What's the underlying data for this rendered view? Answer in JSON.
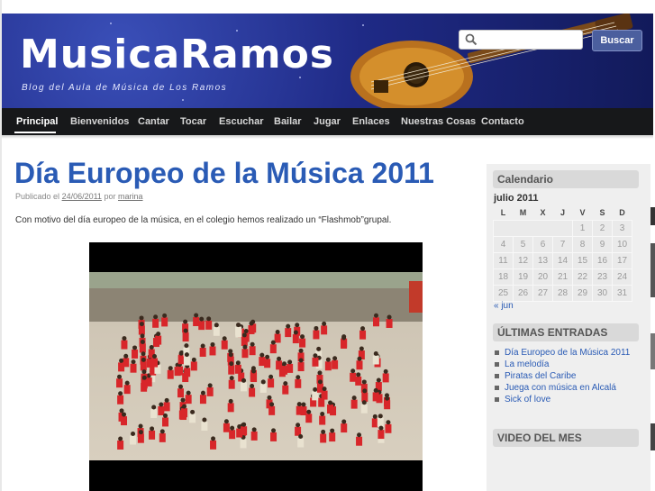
{
  "header": {
    "site_title": "MusicaRamos",
    "tagline": "Blog del Aula de Música de Los Ramos",
    "search_placeholder": "",
    "search_button": "Buscar"
  },
  "nav": {
    "items": [
      "Principal",
      "Bienvenidos",
      "Cantar",
      "Tocar",
      "Escuchar",
      "Bailar",
      "Jugar",
      "Enlaces",
      "Nuestras Cosas",
      "Contacto"
    ],
    "active": "Principal"
  },
  "post": {
    "title": "Día Europeo de la Música 2011",
    "published_prefix": "Publicado el",
    "date": "24/06/2011",
    "by": "por",
    "author": "marina",
    "intro": "Con motivo del día europeo de la música, en el colegio hemos realizado un “Flashmob”grupal."
  },
  "sidebar": {
    "calendar_title": "Calendario",
    "calendar_caption": "julio 2011",
    "weekdays": [
      "L",
      "M",
      "X",
      "J",
      "V",
      "S",
      "D"
    ],
    "weeks": [
      [
        "",
        "",
        "",
        "",
        "1",
        "2",
        "3"
      ],
      [
        "4",
        "5",
        "6",
        "7",
        "8",
        "9",
        "10"
      ],
      [
        "11",
        "12",
        "13",
        "14",
        "15",
        "16",
        "17"
      ],
      [
        "18",
        "19",
        "20",
        "21",
        "22",
        "23",
        "24"
      ],
      [
        "25",
        "26",
        "27",
        "28",
        "29",
        "30",
        "31"
      ]
    ],
    "prev_month": "« jun",
    "recent_title": "ÚLTIMAS ENTRADAS",
    "recent_posts": [
      "Día Europeo de la Música 2011",
      "La melodía",
      "Piratas del Caribe",
      "Juega con música en Alcalá",
      "Sick of love"
    ],
    "video_title": "VIDEO DEL MES"
  },
  "colors": {
    "header_bg": "#1f2a86",
    "nav_bg": "#17181a",
    "link": "#2a5bb5",
    "widget_title_bg": "#d9d9d9"
  }
}
